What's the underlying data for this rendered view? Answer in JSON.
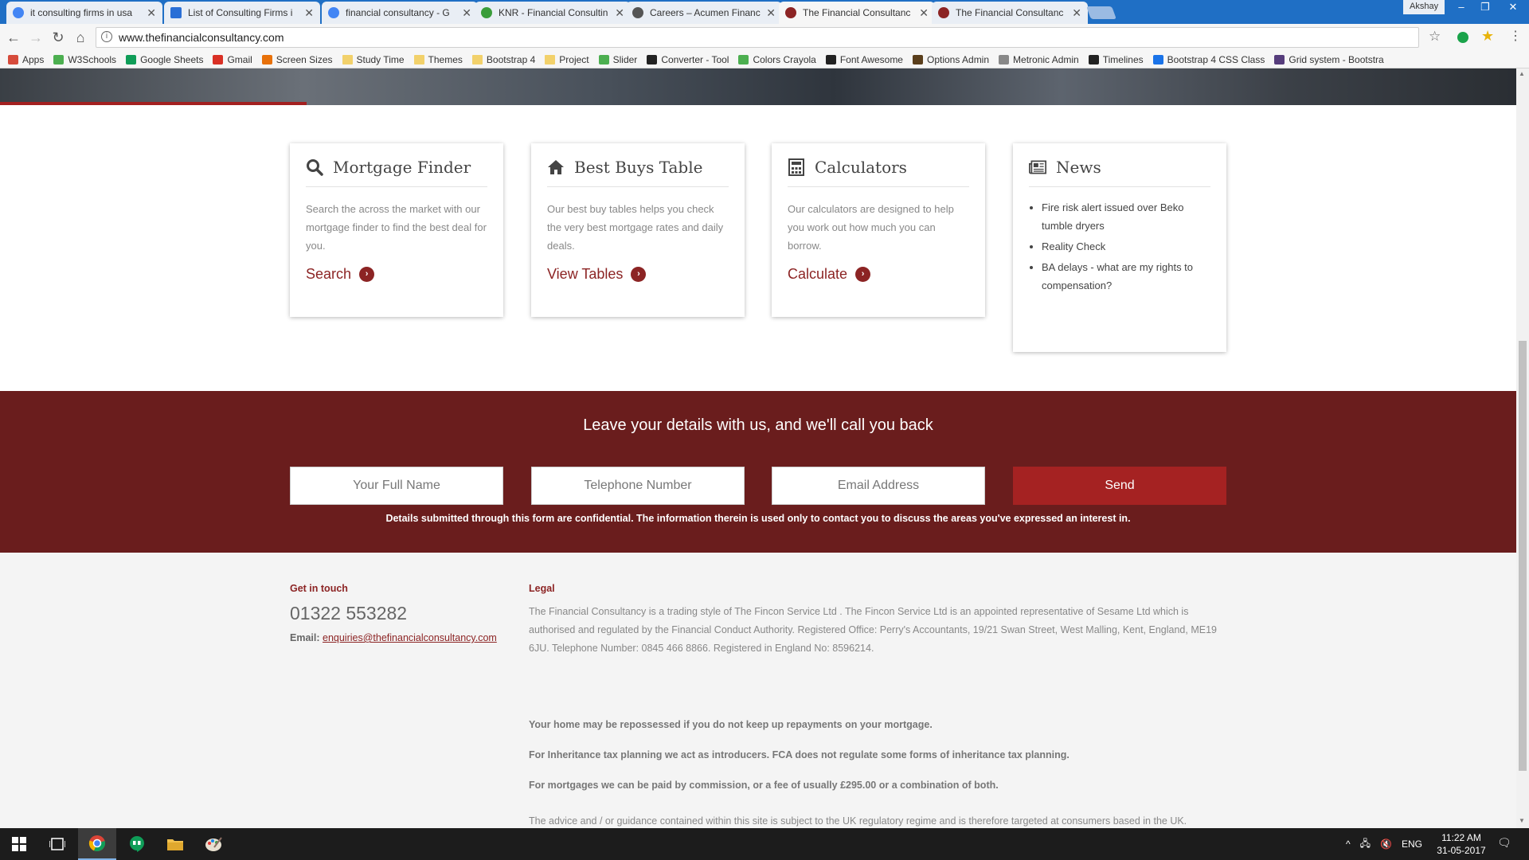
{
  "browser": {
    "tabs": [
      {
        "title": "it consulting firms in usa",
        "favicon": "google-favicon-icon",
        "favicon_color": "#4285f4",
        "active": false
      },
      {
        "title": "List of Consulting Firms i",
        "favicon": "document-favicon-icon",
        "favicon_color": "#2a6fd6",
        "active": false
      },
      {
        "title": "financial consultancy - G",
        "favicon": "google-favicon-icon",
        "favicon_color": "#4285f4",
        "active": false
      },
      {
        "title": "KNR - Financial Consultin",
        "favicon": "knr-favicon-icon",
        "favicon_color": "#3a9d3a",
        "active": false
      },
      {
        "title": "Careers – Acumen Financ",
        "favicon": "acumen-favicon-icon",
        "favicon_color": "#555555",
        "active": false
      },
      {
        "title": "The Financial Consultanc",
        "favicon": "site-favicon-icon",
        "favicon_color": "#8c2424",
        "active": true
      },
      {
        "title": "The Financial Consultanc",
        "favicon": "site-favicon-icon",
        "favicon_color": "#8c2424",
        "active": false
      }
    ],
    "profile_name": "Akshay",
    "url": "www.thefinancialconsultancy.com",
    "bookmarks": [
      {
        "label": "Apps",
        "icon": "apps-grid-icon",
        "color": "#d64b3b"
      },
      {
        "label": "W3Schools",
        "icon": "w3schools-icon",
        "color": "#4caf50"
      },
      {
        "label": "Google Sheets",
        "icon": "sheets-icon",
        "color": "#0f9d58"
      },
      {
        "label": "Gmail",
        "icon": "gmail-icon",
        "color": "#d93025"
      },
      {
        "label": "Screen Sizes",
        "icon": "screen-sizes-icon",
        "color": "#e8710a"
      },
      {
        "label": "Study Time",
        "icon": "folder-icon",
        "color": "#f2d16b"
      },
      {
        "label": "Themes",
        "icon": "folder-icon",
        "color": "#f2d16b"
      },
      {
        "label": "Bootstrap 4",
        "icon": "folder-icon",
        "color": "#f2d16b"
      },
      {
        "label": "Project",
        "icon": "folder-icon",
        "color": "#f2d16b"
      },
      {
        "label": "Slider",
        "icon": "slider-icon",
        "color": "#4caf50"
      },
      {
        "label": "Converter - Tool",
        "icon": "converter-icon",
        "color": "#222222"
      },
      {
        "label": "Colors Crayola",
        "icon": "crayola-icon",
        "color": "#4caf50"
      },
      {
        "label": "Font Awesome",
        "icon": "font-awesome-icon",
        "color": "#222222"
      },
      {
        "label": "Options Admin",
        "icon": "options-admin-icon",
        "color": "#5a3e1b"
      },
      {
        "label": "Metronic Admin",
        "icon": "page-icon",
        "color": "#888888"
      },
      {
        "label": "Timelines",
        "icon": "timelines-icon",
        "color": "#222222"
      },
      {
        "label": "Bootstrap 4 CSS Class",
        "icon": "bootstrap-css-icon",
        "color": "#1a73e8"
      },
      {
        "label": "Grid system - Bootstra",
        "icon": "bootstrap-icon",
        "color": "#563d7c"
      }
    ]
  },
  "cards": [
    {
      "title": "Mortgage Finder",
      "icon": "search-icon",
      "text": "Search the across the market with our mortgage finder to find the best deal for you.",
      "link": "Search"
    },
    {
      "title": "Best Buys Table",
      "icon": "home-icon",
      "text": "Our best buy tables helps you check the very best mortgage rates and daily deals.",
      "link": "View Tables"
    },
    {
      "title": "Calculators",
      "icon": "calculator-icon",
      "text": "Our calculators are designed to help you work out how much you can borrow.",
      "link": "Calculate"
    }
  ],
  "news": {
    "title": "News",
    "icon": "newspaper-icon",
    "items": [
      "Fire risk alert issued over Beko tumble dryers",
      "Reality Check",
      "BA delays - what are my rights to compensation?"
    ]
  },
  "callback": {
    "title": "Leave your details with us, and we'll call you back",
    "name_placeholder": "Your Full Name",
    "phone_placeholder": "Telephone Number",
    "email_placeholder": "Email Address",
    "send_label": "Send",
    "note": "Details submitted through this form are confidential. The information therein is used only to contact you to discuss the areas you've expressed an interest in."
  },
  "footer": {
    "contact_heading": "Get in touch",
    "phone": "01322 553282",
    "email_label": "Email:",
    "email": "enquiries@thefinancialconsultancy.com",
    "legal_heading": "Legal",
    "legal_text": "The Financial Consultancy is a trading style of The Fincon Service Ltd . The Fincon Service Ltd is an appointed representative of Sesame Ltd which is authorised and regulated by the Financial Conduct Authority. Registered Office: Perry's Accountants, 19/21 Swan Street, West Malling, Kent, England, ME19 6JU. Telephone Number: 0845 466 8866. Registered in England No: 8596214.",
    "warning_1": "Your home may be repossessed if you do not keep up repayments on your mortgage.",
    "warning_2": "For Inheritance tax planning we act as introducers. FCA does not regulate some forms of inheritance tax planning.",
    "warning_3": "For mortgages we can be paid by commission, or a fee of usually £295.00 or a combination of both.",
    "last_line": "The advice and / or guidance contained within this site is subject to the UK regulatory regime and is therefore targeted at consumers based in the UK."
  },
  "taskbar": {
    "language": "ENG",
    "time": "11:22 AM",
    "date": "31-05-2017"
  },
  "colors": {
    "brand_red": "#8c2424",
    "callback_bg": "#6a1d1d",
    "send_bg": "#a52222"
  }
}
